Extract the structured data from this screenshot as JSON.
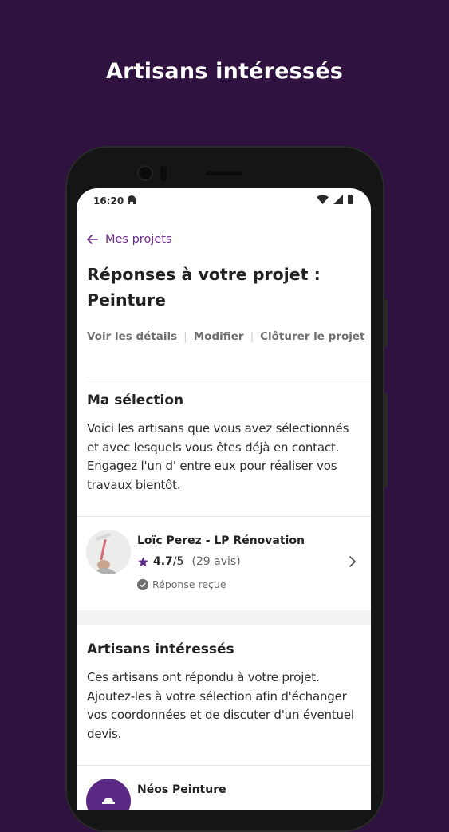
{
  "headline": "Artisans intéressés",
  "statusbar": {
    "time": "16:20"
  },
  "nav": {
    "back_label": "Mes projets"
  },
  "page": {
    "title": "Réponses à votre projet : Peinture"
  },
  "actions": [
    {
      "label": "Voir les détails"
    },
    {
      "label": "Modifier"
    },
    {
      "label": "Clôturer le projet"
    }
  ],
  "selection": {
    "title": "Ma sélection",
    "text": "Voici les artisans que vous avez sélectionnés et avec lesquels vous êtes déjà en contact. Engagez l'un d' entre eux pour réaliser vos travaux bientôt.",
    "artisan": {
      "name": "Loïc Perez - LP Rénovation",
      "rating": "4.7",
      "rating_max": "/5",
      "reviews": "(29 avis)",
      "status": "Réponse reçue"
    }
  },
  "interested": {
    "title": "Artisans intéressés",
    "text": "Ces artisans ont répondu à votre projet. Ajoutez-les à votre sélection afin d'échanger vos coordonnées et de discuter d'un éventuel devis.",
    "artisan": {
      "name": "Néos Peinture"
    }
  },
  "colors": {
    "background": "#2f1240",
    "accent": "#6b2c8a",
    "star": "#5b2a86"
  }
}
